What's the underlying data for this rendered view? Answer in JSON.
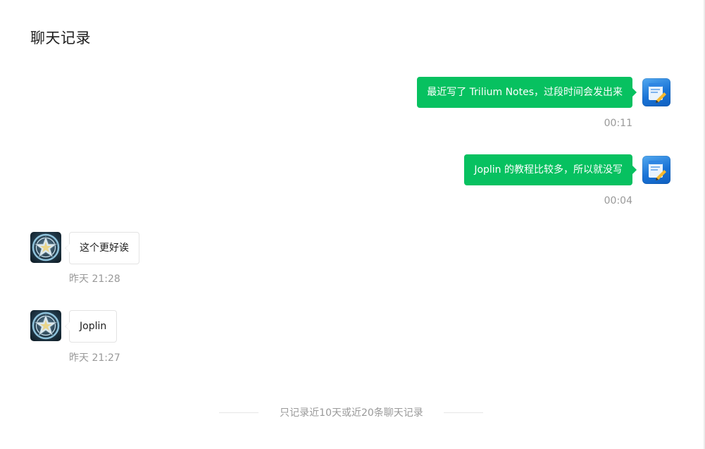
{
  "page": {
    "title": "聊天记录"
  },
  "messages": [
    {
      "direction": "out",
      "text": "最近写了 Trilium Notes，过段时间会发出来",
      "time": "00:11",
      "avatar_icon": "notebook-pencil-icon"
    },
    {
      "direction": "out",
      "text": "Joplin 的教程比较多，所以就没写",
      "time": "00:04",
      "avatar_icon": "notebook-pencil-icon"
    },
    {
      "direction": "in",
      "text": "这个更好诶",
      "time": "昨天 21:28",
      "avatar_icon": "star-emblem-icon"
    },
    {
      "direction": "in",
      "text": "Joplin",
      "time": "昨天 21:27",
      "avatar_icon": "star-emblem-icon"
    }
  ],
  "footer": {
    "note": "只记录近10天或近20条聊天记录"
  },
  "colors": {
    "accent": "#07c160",
    "muted_text": "#999999",
    "title_text": "#1f1f1f"
  }
}
